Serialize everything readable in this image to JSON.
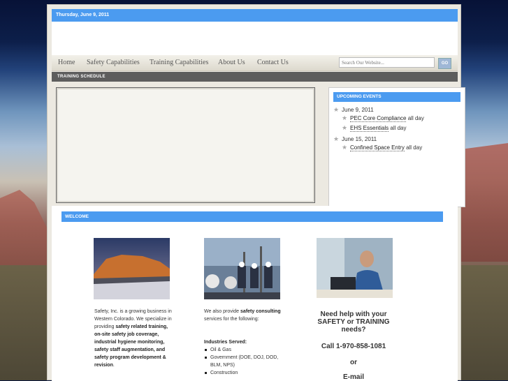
{
  "header": {
    "date": "Thursday, June 9, 2011"
  },
  "nav": {
    "items": [
      "Home",
      "Safety Capabilities",
      "Training Capabilities",
      "About Us",
      "Contact Us"
    ],
    "search_placeholder": "Search Our Website...",
    "go_label": "GO"
  },
  "schedule": {
    "title": "TRAINING SCHEDULE"
  },
  "events": {
    "title": "UPCOMING EVENTS",
    "groups": [
      {
        "date": "June 9, 2011",
        "items": [
          {
            "name": "PEC Core Compliance",
            "time": "all day"
          },
          {
            "name": "EHS Essentials",
            "time": "all day"
          }
        ]
      },
      {
        "date": "June 15, 2011",
        "items": [
          {
            "name": "Confined Space Entry",
            "time": "all day"
          }
        ]
      }
    ]
  },
  "welcome": {
    "title": "WELCOME",
    "col1": {
      "intro": "Safety, Inc. is a growing business in Western Colorado. We specialize in providing",
      "bold": "safety related training, on-site safety job coverage, industrial hygiene monitoring,",
      "bold2": "safety staff augmentation, and safety program development & revision",
      "end": "."
    },
    "col2": {
      "intro": "We also provide",
      "bold": "safety consulting",
      "end": "services for the following:",
      "industries_label": "Industries Served:",
      "industries": [
        "Oil & Gas",
        "Government (DOE, DOJ, DOD, BLM, NPS)",
        "Construction"
      ]
    },
    "col3": {
      "need_help": "Need help with your SAFETY or TRAINING needs?",
      "call": "Call 1-970-858-1081",
      "or": "or",
      "email": "E-mail"
    }
  },
  "colors": {
    "accent": "#4b9bf0",
    "dark_bar": "#5d5d5d"
  }
}
